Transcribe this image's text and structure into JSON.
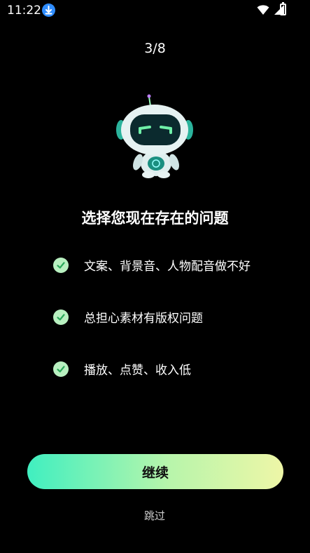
{
  "status_bar": {
    "time": "11:22",
    "icons": [
      "download-icon",
      "wifi-icon",
      "signal-icon",
      "battery-icon"
    ]
  },
  "step_indicator": "3/8",
  "title": "选择您现在存在的问题",
  "options": [
    {
      "label": "文案、背景音、人物配音做不好",
      "checked": true
    },
    {
      "label": "总担心素材有版权问题",
      "checked": true
    },
    {
      "label": "播放、点赞、收入低",
      "checked": true
    }
  ],
  "continue_label": "继续",
  "skip_label": "跳过",
  "colors": {
    "background": "#000000",
    "check_fill": "#b8f0c0",
    "check_mark": "#2aa85a",
    "button_gradient_start": "#40efc0",
    "button_gradient_end": "#eef6a7"
  }
}
